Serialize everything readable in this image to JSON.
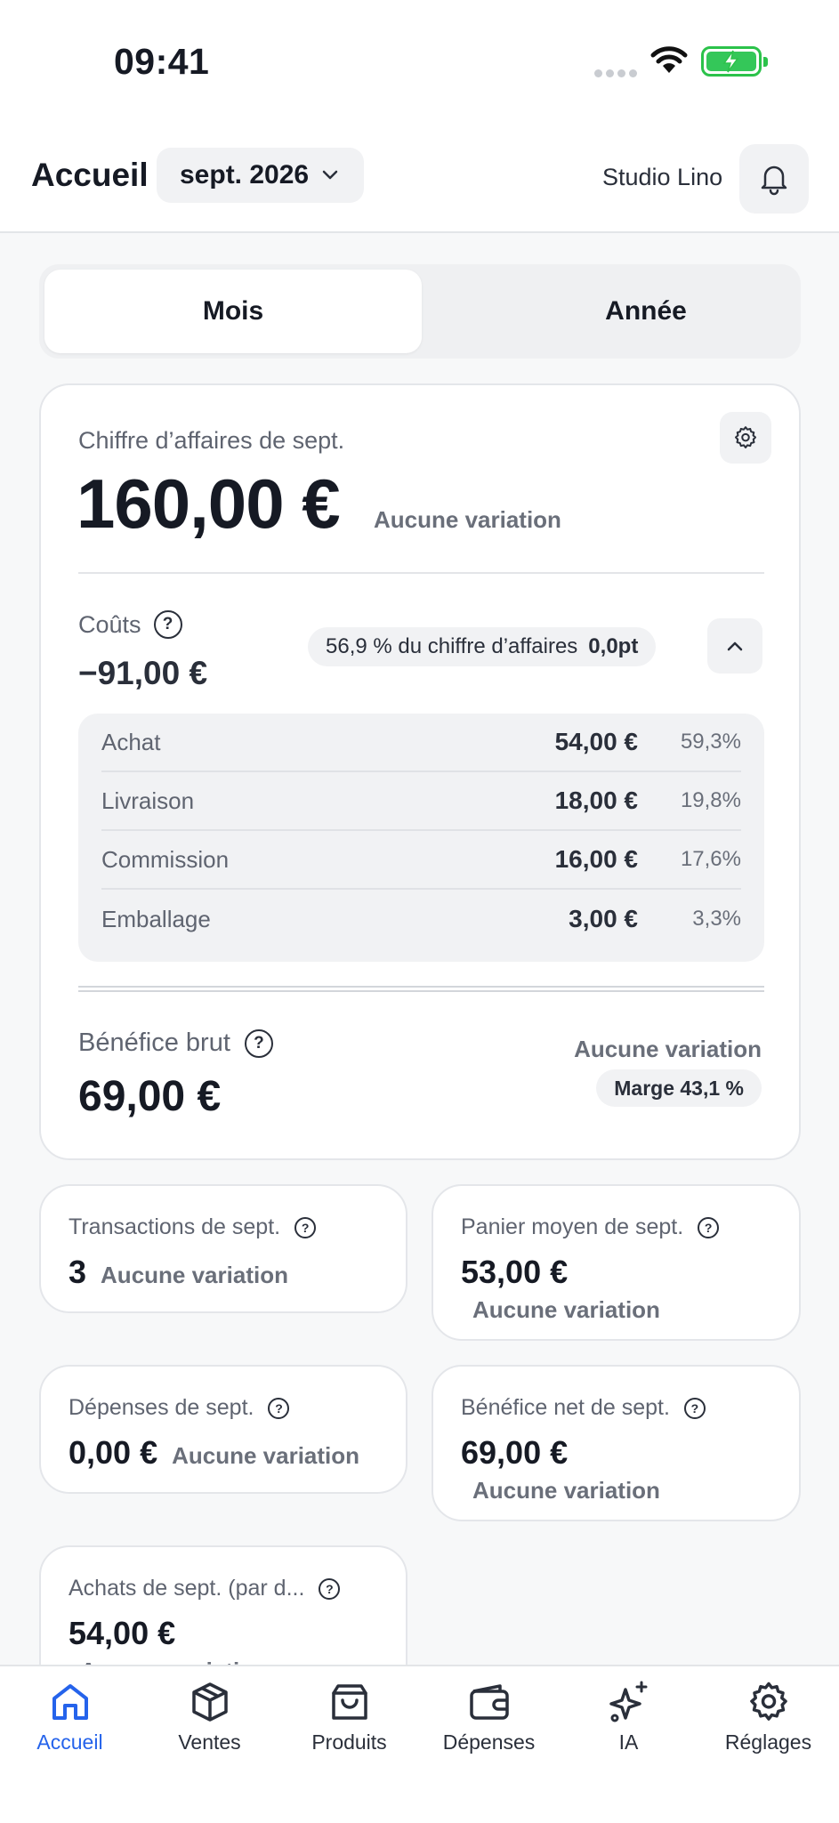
{
  "status_bar": {
    "time": "09:41"
  },
  "header": {
    "title": "Accueil",
    "month_selector": "sept. 2026",
    "store_name": "Studio Lino"
  },
  "segment": {
    "tabs": [
      "Mois",
      "Année"
    ],
    "active": "Mois"
  },
  "revenue_card": {
    "label": "Chiffre d’affaires de sept.",
    "value": "160,00 €",
    "variation": "Aucune variation",
    "costs": {
      "label": "Coûts",
      "value": "−91,00 €",
      "share_label": "56,9 % du chiffre d’affaires",
      "share_delta": "0,0pt",
      "breakdown": [
        {
          "name": "Achat",
          "amount": "54,00 €",
          "pct": "59,3%"
        },
        {
          "name": "Livraison",
          "amount": "18,00 €",
          "pct": "19,8%"
        },
        {
          "name": "Commission",
          "amount": "16,00 €",
          "pct": "17,6%"
        },
        {
          "name": "Emballage",
          "amount": "3,00 €",
          "pct": "3,3%"
        }
      ]
    },
    "gross_profit": {
      "label": "Bénéfice brut",
      "value": "69,00 €",
      "variation": "Aucune variation",
      "margin": "Marge 43,1 %"
    }
  },
  "cards": {
    "transactions": {
      "label": "Transactions de sept.",
      "value": "3",
      "variation": "Aucune variation"
    },
    "avg_basket": {
      "label": "Panier moyen de sept.",
      "value": "53,00 €",
      "variation": "Aucune variation"
    },
    "expenses": {
      "label": "Dépenses de sept.",
      "value": "0,00 €",
      "variation": "Aucune variation"
    },
    "net_profit": {
      "label": "Bénéfice net de sept.",
      "value": "69,00 €",
      "variation": "Aucune variation"
    },
    "purchases": {
      "label": "Achats de sept. (par d...",
      "value": "54,00 €",
      "variation": "Aucune variation"
    }
  },
  "tabbar": {
    "items": [
      {
        "label": "Accueil",
        "icon": "home-icon",
        "active": true
      },
      {
        "label": "Ventes",
        "icon": "box-icon"
      },
      {
        "label": "Produits",
        "icon": "shopping-bag-icon"
      },
      {
        "label": "Dépenses",
        "icon": "wallet-icon"
      },
      {
        "label": "IA",
        "icon": "sparkles-icon"
      },
      {
        "label": "Réglages",
        "icon": "gear-icon"
      }
    ]
  },
  "colors": {
    "accent": "#2563eb",
    "battery": "#34c759"
  }
}
